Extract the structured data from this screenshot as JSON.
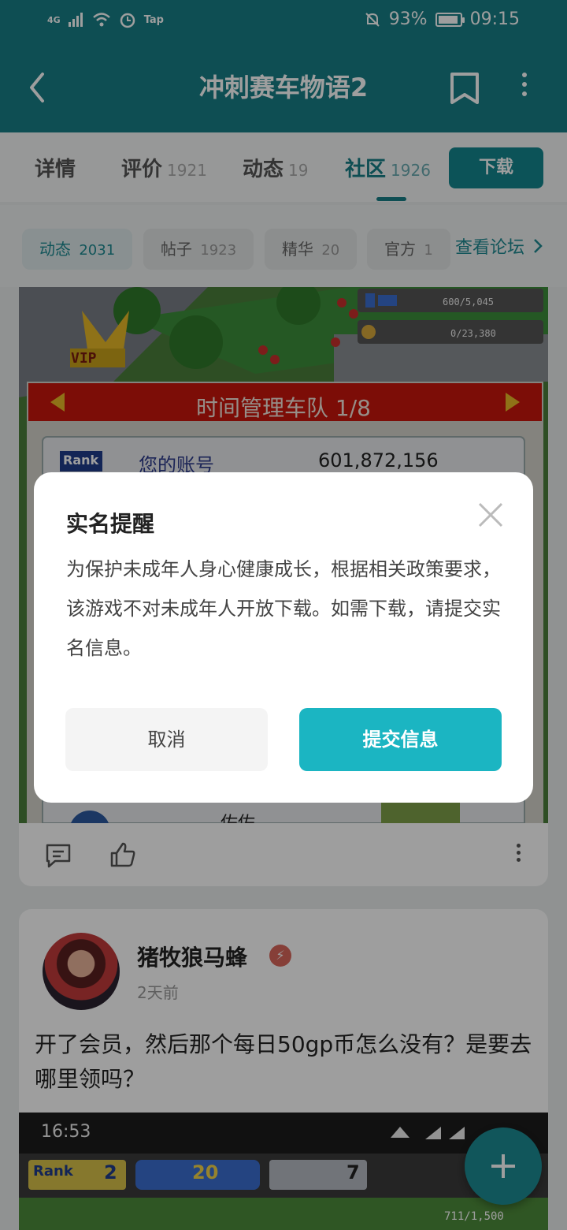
{
  "status_bar": {
    "network": "4G",
    "carrier_app": "Tap",
    "battery": "93%",
    "battery_level": 0.93,
    "time": "09:15"
  },
  "app_bar": {
    "title": "冲刺赛车物语2"
  },
  "tabs": [
    {
      "label": "详情",
      "count": ""
    },
    {
      "label": "评价",
      "count": "1921"
    },
    {
      "label": "动态",
      "count": "19"
    },
    {
      "label": "社区",
      "count": "1926"
    }
  ],
  "download_label": "下载",
  "chips": [
    {
      "label": "动态",
      "count": "2031"
    },
    {
      "label": "帖子",
      "count": "1923"
    },
    {
      "label": "精华",
      "count": "20"
    },
    {
      "label": "官方",
      "count": "1"
    }
  ],
  "forum_link": "查看论坛",
  "game_screenshot": {
    "gauge1": "600/5,045",
    "gauge2": "0/23,380",
    "vip": "VIP",
    "team_header": "时间管理车队 1/8",
    "rank_label": "Rank",
    "account_label": "您的账号",
    "account_number": "601,872,156",
    "bottom_text": "佐佐"
  },
  "post": {
    "username": "猪牧狼马蜂",
    "time": "2天前",
    "text": "开了会员，然后那个每日50gp币怎么没有？是要去哪里领吗？",
    "shot_time": "16:53",
    "shot_rank": "Rank",
    "shot_rank_value": "2",
    "shot_gp": "20",
    "shot_pc": "7",
    "shot_gauge": "711/1,500"
  },
  "dialog": {
    "title": "实名提醒",
    "body": "为保护未成年人身心健康成长，根据相关政策要求，该游戏不对未成年人开放下载。如需下载，请提交实名信息。",
    "cancel": "取消",
    "submit": "提交信息"
  },
  "colors": {
    "primary": "#177f86",
    "accent": "#1bb5c2"
  }
}
